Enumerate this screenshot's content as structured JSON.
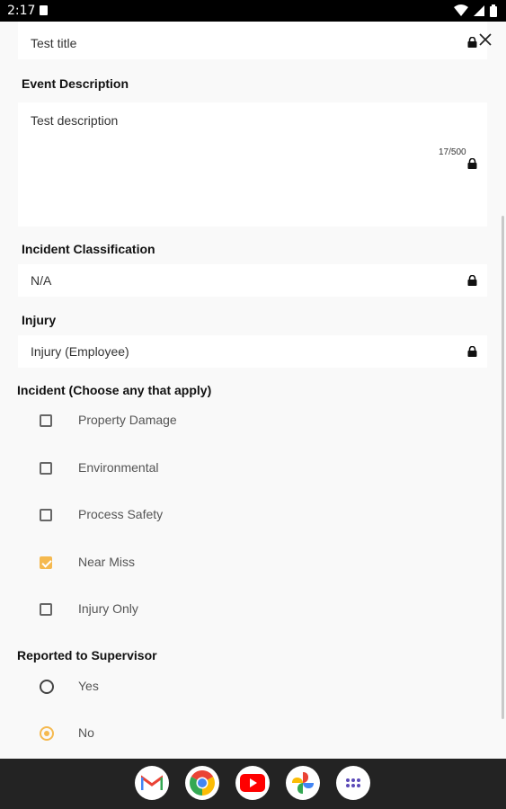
{
  "status_bar": {
    "time": "2:17"
  },
  "form": {
    "title_value": "Test title",
    "event_description": {
      "label": "Event Description",
      "value": "Test description",
      "counter": "17/500"
    },
    "incident_classification": {
      "label": "Incident Classification",
      "value": "N/A"
    },
    "injury": {
      "label": "Injury",
      "value": "Injury (Employee)"
    },
    "incident": {
      "label": "Incident (Choose any that apply)",
      "options": [
        {
          "label": "Property Damage",
          "checked": false
        },
        {
          "label": "Environmental",
          "checked": false
        },
        {
          "label": "Process Safety",
          "checked": false
        },
        {
          "label": "Near Miss",
          "checked": true
        },
        {
          "label": "Injury Only",
          "checked": false
        }
      ]
    },
    "reported_to_supervisor": {
      "label": "Reported to Supervisor",
      "options": [
        {
          "label": "Yes",
          "selected": false
        },
        {
          "label": "No",
          "selected": true
        }
      ]
    }
  },
  "dock_apps": [
    "gmail-icon",
    "chrome-icon",
    "youtube-icon",
    "photos-icon",
    "app-drawer-icon"
  ],
  "colors": {
    "accent": "#f5b94f",
    "navbar": "#232323",
    "status_bar": "#000000"
  }
}
